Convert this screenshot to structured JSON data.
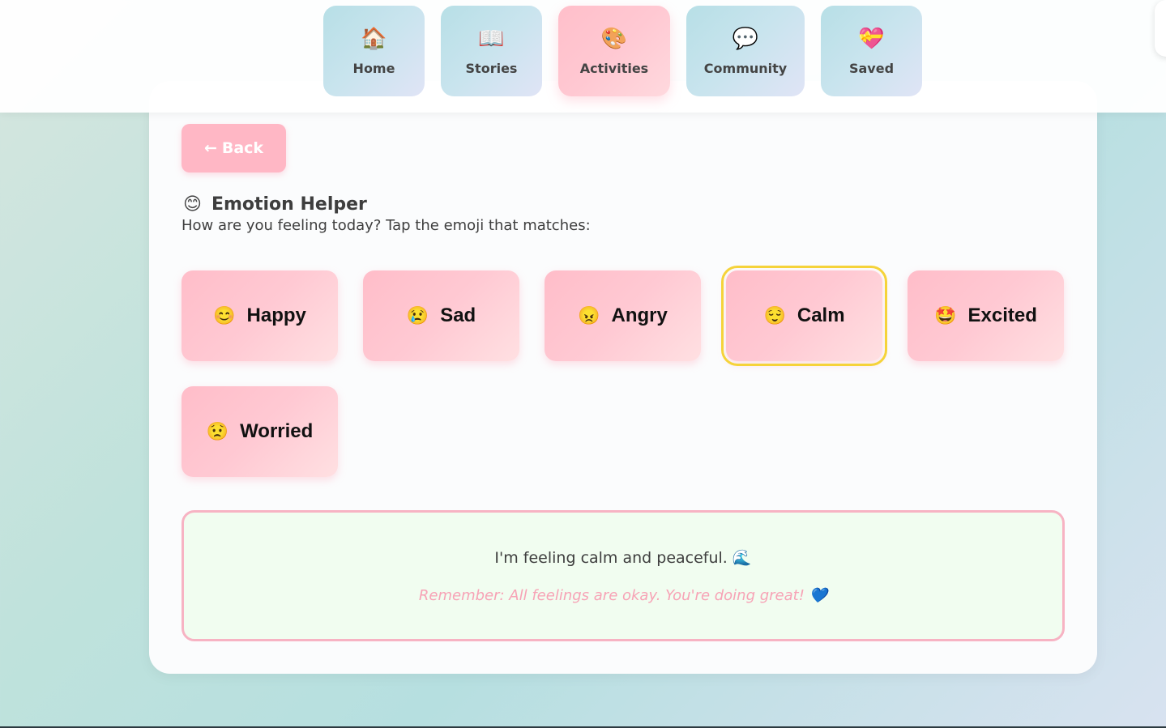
{
  "nav": {
    "items": [
      {
        "label": "Home",
        "icon": "🏠",
        "icon_name": "house-icon"
      },
      {
        "label": "Stories",
        "icon": "📖",
        "icon_name": "book-icon"
      },
      {
        "label": "Activities",
        "icon": "🎨",
        "icon_name": "palette-icon"
      },
      {
        "label": "Community",
        "icon": "💬",
        "icon_name": "speech-bubble-icon"
      },
      {
        "label": "Saved",
        "icon": "💝",
        "icon_name": "heart-gift-icon"
      }
    ],
    "active_index": 2
  },
  "back_button": {
    "arrow": "←",
    "label": "Back"
  },
  "header": {
    "icon": "😊",
    "title": "Emotion Helper",
    "subtitle": "How are you feeling today? Tap the emoji that matches:"
  },
  "emotions": [
    {
      "icon": "😊",
      "label": "Happy"
    },
    {
      "icon": "😢",
      "label": "Sad"
    },
    {
      "icon": "😠",
      "label": "Angry"
    },
    {
      "icon": "😌",
      "label": "Calm"
    },
    {
      "icon": "🤩",
      "label": "Excited"
    },
    {
      "icon": "😟",
      "label": "Worried"
    }
  ],
  "selected_emotion": "Calm",
  "message": {
    "text": "I'm feeling calm and peaceful.",
    "text_icon": "🌊",
    "note": "Remember: All feelings are okay. You're doing great!",
    "note_icon": "💙"
  },
  "colors": {
    "accent_pink": "#ffb7c5",
    "selected_outline": "#f5d33a",
    "message_bg": "#f1fdf0",
    "note_pink": "#f7a3b6"
  }
}
